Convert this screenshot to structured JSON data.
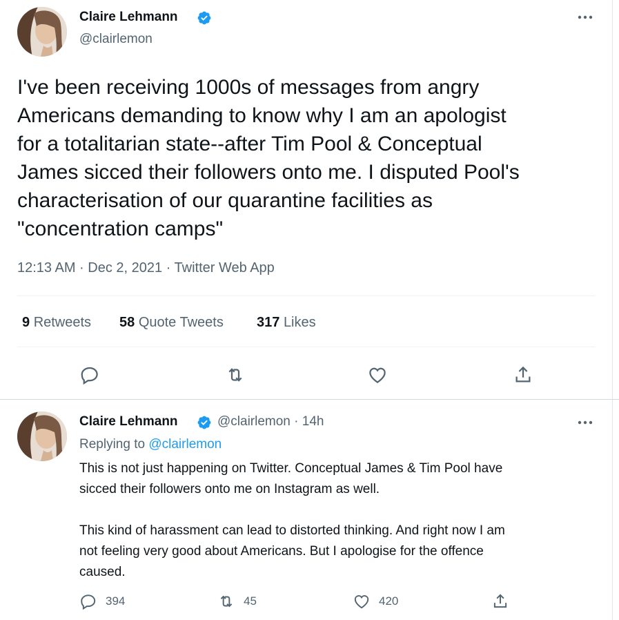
{
  "main_tweet": {
    "author_name": "Claire Lehmann",
    "author_handle": "@clairlemon",
    "text": "I've been receiving 1000s of messages from angry\nAmericans demanding to know why I am an apologist\nfor a totalitarian state--after Tim Pool & Conceptual\nJames sicced their followers onto me. I disputed Pool's\ncharacterisation of our quarantine facilities as\n\"concentration camps\"",
    "timestamp": "12:13 AM · Dec 2, 2021 · Twitter Web App",
    "stats": {
      "retweets_count": "9",
      "retweets_label": "Retweets",
      "quote_count": "58",
      "quote_label": "Quote Tweets",
      "likes_count": "317",
      "likes_label": "Likes"
    }
  },
  "reply_tweet": {
    "author_name": "Claire Lehmann",
    "author_handle": "@clairlemon",
    "time": "· 14h",
    "replying_prefix": "Replying to",
    "replying_handle": "@clairlemon",
    "text": "This is not just happening on Twitter. Conceptual James & Tim Pool have\nsicced their followers onto me on Instagram as well.\n\nThis kind of harassment can lead to distorted thinking. And right now I am\nnot feeling very good about Americans. But I apologise for the offence\ncaused.",
    "reply_count": "394",
    "retweet_count": "45",
    "like_count": "420"
  },
  "icons": {
    "verified": "verified-badge-icon",
    "more": "more-icon",
    "reply": "reply-icon",
    "retweet": "retweet-icon",
    "like": "heart-icon",
    "share": "share-icon"
  },
  "colors": {
    "verified": "#1d9bf0",
    "link": "#1d9bf0",
    "secondary_text": "#536471",
    "primary_text": "#0f1419"
  }
}
